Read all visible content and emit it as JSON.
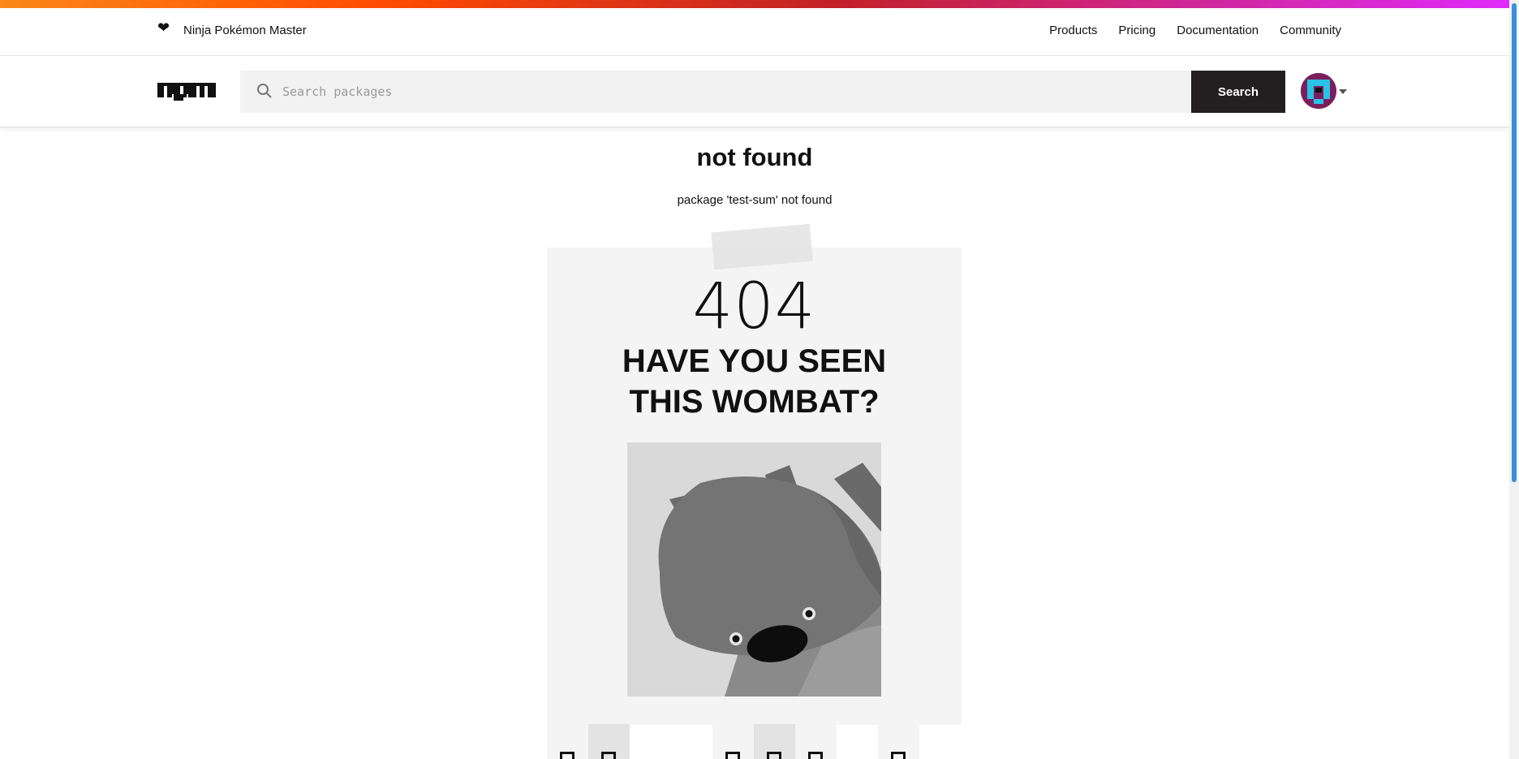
{
  "colors": {
    "rainbow": [
      "#fb8817",
      "#ff4b01",
      "#c12127",
      "#e02aff"
    ],
    "search_button_bg": "#231f20",
    "poster_bg": "#f4f4f4",
    "scroll_thumb": "#3b8fd6"
  },
  "topbar": {
    "heart_icon": "heart-icon",
    "tagline": "Ninja Pokémon Master",
    "nav": [
      "Products",
      "Pricing",
      "Documentation",
      "Community"
    ]
  },
  "header": {
    "logo_icon": "npm-logo",
    "search_placeholder": "Search packages",
    "search_button": "Search",
    "avatar_icon": "user-avatar"
  },
  "main": {
    "title": "not found",
    "message": "package 'test-sum' not found",
    "poster": {
      "code": "404",
      "headline_line1": "HAVE YOU SEEN",
      "headline_line2": "THIS WOMBAT?"
    }
  }
}
